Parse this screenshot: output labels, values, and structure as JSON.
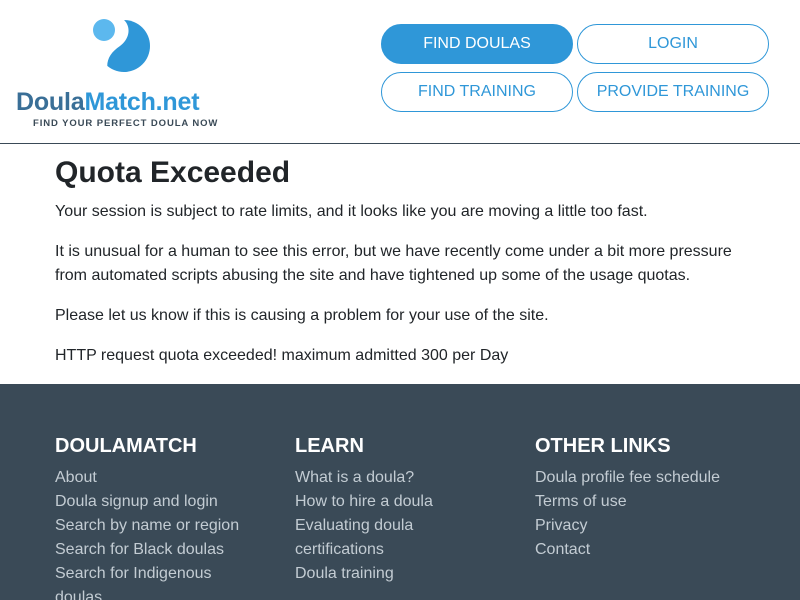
{
  "header": {
    "logo": {
      "word_part1": "Doula",
      "word_part2": "Match.net",
      "tagline": "FIND YOUR PERFECT DOULA NOW"
    },
    "nav": {
      "find_doulas": "FIND DOULAS",
      "login": "LOGIN",
      "find_training": "FIND TRAINING",
      "provide_training": "PROVIDE TRAINING"
    }
  },
  "main": {
    "title": "Quota Exceeded",
    "paragraphs": [
      "Your session is subject to rate limits, and it looks like you are moving a little too fast.",
      "It is unusual for a human to see this error, but we have recently come under a bit more pressure from automated scripts abusing the site and have tightened up some of the usage quotas.",
      "Please let us know if this is causing a problem for your use of the site.",
      "HTTP request quota exceeded! maximum admitted 300 per Day"
    ]
  },
  "footer": {
    "columns": [
      {
        "heading": "DOULAMATCH",
        "links": [
          "About",
          "Doula signup and login",
          "Search by name or region",
          "Search for Black doulas",
          "Search for Indigenous doulas"
        ]
      },
      {
        "heading": "LEARN",
        "links": [
          "What is a doula?",
          "How to hire a doula",
          "Evaluating doula certifications",
          "Doula training"
        ]
      },
      {
        "heading": "OTHER LINKS",
        "links": [
          "Doula profile fee schedule",
          "Terms of use",
          "Privacy",
          "Contact"
        ]
      }
    ]
  },
  "colors": {
    "brand_blue": "#2f97d8",
    "brand_dark_blue": "#3a6f97",
    "footer_bg": "#3a4a57",
    "footer_link": "#c3ccd3"
  }
}
